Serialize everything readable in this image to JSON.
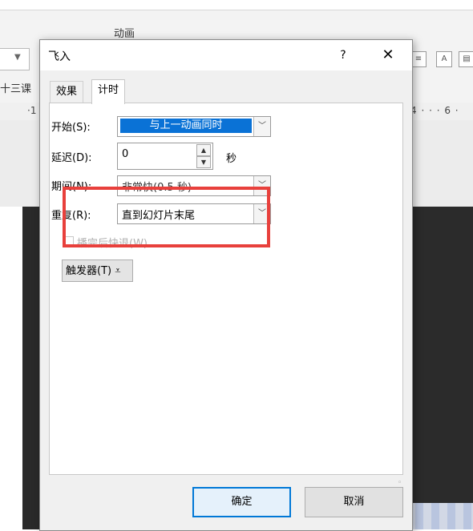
{
  "background": {
    "ribbon_group_label": "动画",
    "slide_tab_label": "十三课",
    "ruler_left_text": "·1",
    "ruler_right_text": "4 · · · 6 ·"
  },
  "dialog": {
    "title": "飞入",
    "help_label": "?",
    "close_label": "✕",
    "tabs": [
      {
        "label": "效果",
        "active": false
      },
      {
        "label": "计时",
        "active": true
      }
    ],
    "start": {
      "label": "开始(S):",
      "value": "与上一动画同时"
    },
    "delay": {
      "label": "延迟(D):",
      "value": "0",
      "unit": "秒"
    },
    "duration": {
      "label": "期间(N):",
      "value": "非常快(0.5 秒)"
    },
    "repeat": {
      "label": "重复(R):",
      "value": "直到幻灯片末尾"
    },
    "rewind": {
      "label": "播完后快退(W)",
      "checked": false,
      "enabled": false
    },
    "trigger_label": "触发器(T)",
    "ok_label": "确定",
    "cancel_label": "取消"
  },
  "colors": {
    "selected_blue": "#0a72d6",
    "highlight_red": "#e8403c",
    "ok_border": "#0078d7"
  }
}
